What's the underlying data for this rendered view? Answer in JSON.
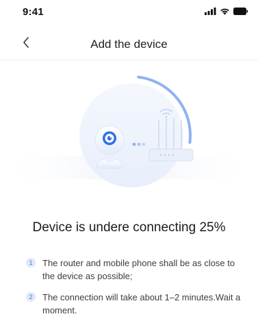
{
  "status_bar": {
    "time": "9:41",
    "icons": [
      "cellular-signal-icon",
      "wifi-icon",
      "battery-icon"
    ]
  },
  "nav": {
    "back_icon": "chevron-left-icon",
    "title": "Add the device"
  },
  "illustration": {
    "progress_fraction": 0.25,
    "icons": [
      "camera-icon",
      "router-icon",
      "wifi-icon"
    ]
  },
  "status": {
    "text": "Device is undere connecting 25%"
  },
  "tips": [
    {
      "number": "1",
      "text": "The router and mobile phone shall be as close to the device as possible;"
    },
    {
      "number": "2",
      "text": "The connection will take about 1–2 minutes.Wait a moment."
    }
  ],
  "colors": {
    "accent": "#3a74e8",
    "progress_arc": "#8fb2f2",
    "illustration_bg": "#eef3fc"
  }
}
